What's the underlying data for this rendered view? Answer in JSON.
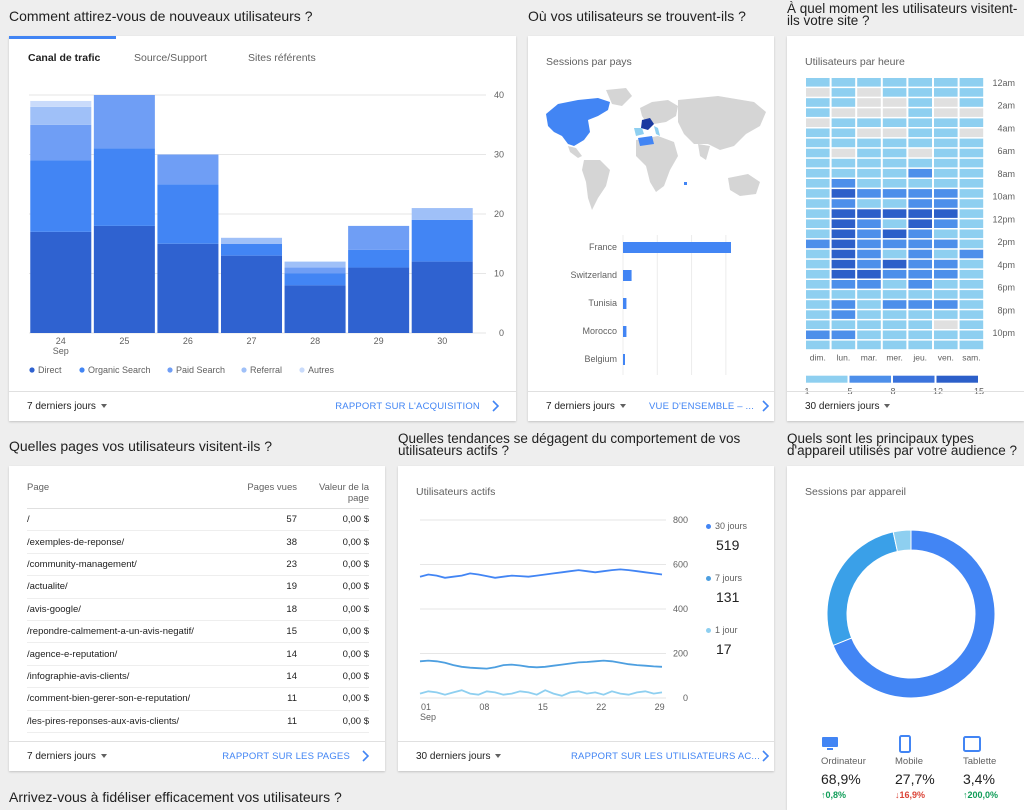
{
  "questions": {
    "acquisition": "Comment attirez-vous de nouveaux utilisateurs ?",
    "geo": "Où vos utilisateurs se trouvent-ils ?",
    "time": "À quel moment les utilisateurs visitent-ils votre site ?",
    "pages": "Quelles pages vos utilisateurs visitent-ils ?",
    "trends": "Quelles tendances se dégagent du comportement de vos utilisateurs actifs ?",
    "devices": "Quels sont les principaux types d'appareil utilisés par votre audience ?",
    "retention": "Arrivez-vous à fidéliser efficacement vos utilisateurs ?"
  },
  "acquisition": {
    "tabs": [
      "Canal de trafic",
      "Source/Support",
      "Sites référents"
    ],
    "date_range": "7 derniers jours",
    "link": "RAPPORT SUR L'ACQUISITION"
  },
  "geo": {
    "subtitle": "Sessions par pays",
    "date_range": "7 derniers jours",
    "link": "VUE D'ENSEMBLE – ..."
  },
  "time": {
    "subtitle": "Utilisateurs par heure",
    "date_range": "30 derniers jours",
    "days": [
      "dim.",
      "lun.",
      "mar.",
      "mer.",
      "jeu.",
      "ven.",
      "sam."
    ],
    "hours": [
      "12am",
      "2am",
      "4am",
      "6am",
      "8am",
      "10am",
      "12pm",
      "2pm",
      "4pm",
      "6pm",
      "8pm",
      "10pm"
    ],
    "scale_ticks": [
      "1",
      "5",
      "8",
      "12",
      "15"
    ],
    "colors": [
      "#e0e0e0",
      "#8ecff0",
      "#4d8fea",
      "#2c5fc9"
    ],
    "grid": [
      [
        1,
        1,
        1,
        1,
        1,
        1,
        1
      ],
      [
        0,
        1,
        0,
        1,
        1,
        1,
        1
      ],
      [
        1,
        1,
        0,
        0,
        1,
        0,
        1
      ],
      [
        1,
        0,
        0,
        0,
        1,
        0,
        0
      ],
      [
        0,
        1,
        1,
        1,
        1,
        1,
        1
      ],
      [
        1,
        1,
        0,
        0,
        1,
        1,
        0
      ],
      [
        1,
        1,
        1,
        1,
        1,
        1,
        1
      ],
      [
        1,
        0,
        1,
        1,
        0,
        1,
        1
      ],
      [
        1,
        1,
        1,
        1,
        1,
        1,
        1
      ],
      [
        1,
        1,
        1,
        1,
        2,
        1,
        1
      ],
      [
        1,
        2,
        1,
        1,
        1,
        1,
        1
      ],
      [
        1,
        3,
        2,
        2,
        2,
        2,
        1
      ],
      [
        1,
        2,
        1,
        1,
        2,
        2,
        1
      ],
      [
        1,
        3,
        3,
        3,
        3,
        3,
        1
      ],
      [
        1,
        3,
        2,
        1,
        3,
        2,
        1
      ],
      [
        1,
        3,
        2,
        3,
        2,
        1,
        1
      ],
      [
        2,
        3,
        2,
        2,
        2,
        2,
        1
      ],
      [
        1,
        3,
        2,
        1,
        2,
        1,
        2
      ],
      [
        1,
        3,
        2,
        3,
        2,
        2,
        1
      ],
      [
        1,
        3,
        3,
        2,
        2,
        2,
        1
      ],
      [
        1,
        2,
        2,
        1,
        2,
        1,
        1
      ],
      [
        1,
        1,
        1,
        1,
        1,
        1,
        1
      ],
      [
        1,
        2,
        1,
        2,
        2,
        2,
        1
      ],
      [
        1,
        2,
        1,
        1,
        1,
        1,
        1
      ],
      [
        1,
        1,
        1,
        1,
        1,
        0,
        1
      ],
      [
        2,
        2,
        1,
        1,
        1,
        1,
        1
      ],
      [
        1,
        1,
        1,
        1,
        1,
        1,
        1
      ]
    ]
  },
  "pages": {
    "headers": [
      "Page",
      "Pages vues",
      "Valeur de la page"
    ],
    "rows": [
      [
        "/",
        "57",
        "0,00 $"
      ],
      [
        "/exemples-de-reponse/",
        "38",
        "0,00 $"
      ],
      [
        "/community-management/",
        "23",
        "0,00 $"
      ],
      [
        "/actualite/",
        "19",
        "0,00 $"
      ],
      [
        "/avis-google/",
        "18",
        "0,00 $"
      ],
      [
        "/repondre-calmement-a-un-avis-negatif/",
        "15",
        "0,00 $"
      ],
      [
        "/agence-e-reputation/",
        "14",
        "0,00 $"
      ],
      [
        "/infographie-avis-clients/",
        "14",
        "0,00 $"
      ],
      [
        "/comment-bien-gerer-son-e-reputation/",
        "11",
        "0,00 $"
      ],
      [
        "/les-pires-reponses-aux-avis-clients/",
        "11",
        "0,00 $"
      ]
    ],
    "date_range": "7 derniers jours",
    "link": "RAPPORT SUR LES PAGES"
  },
  "trends": {
    "subtitle": "Utilisateurs actifs",
    "date_range": "30 derniers jours",
    "link": "RAPPORT SUR LES UTILISATEURS AC...",
    "summary": [
      {
        "label": "30 jours",
        "value": "519",
        "color": "#4285f4"
      },
      {
        "label": "7 jours",
        "value": "131",
        "color": "#4d9fe0"
      },
      {
        "label": "1 jour",
        "value": "17",
        "color": "#8ecff0"
      }
    ]
  },
  "devices": {
    "subtitle": "Sessions par appareil",
    "items": [
      {
        "label": "Ordinateur",
        "value": "68,9%",
        "change": "↑0,8%",
        "color": "#4285f4",
        "change_color": "#0f9d58",
        "icon": "desktop-icon"
      },
      {
        "label": "Mobile",
        "value": "27,7%",
        "change": "↓16,9%",
        "color": "#3aa0e8",
        "change_color": "#db4437",
        "icon": "mobile-icon"
      },
      {
        "label": "Tablette",
        "value": "3,4%",
        "change": "↑200,0%",
        "color": "#8ecff0",
        "change_color": "#0f9d58",
        "icon": "tablet-icon"
      }
    ]
  },
  "chart_data": [
    {
      "type": "bar",
      "title": "Canal de trafic",
      "categories": [
        "24 Sep",
        "25",
        "26",
        "27",
        "28",
        "29",
        "30"
      ],
      "ylim": [
        0,
        40
      ],
      "yticks": [
        "40",
        "30",
        "20",
        "10",
        "0"
      ],
      "legend": "bottom",
      "series": [
        {
          "name": "Direct",
          "color": "#2f62d0",
          "values": [
            17,
            18,
            15,
            13,
            8,
            11,
            12
          ]
        },
        {
          "name": "Organic Search",
          "color": "#4285f4",
          "values": [
            12,
            13,
            10,
            2,
            2,
            3,
            7
          ]
        },
        {
          "name": "Paid Search",
          "color": "#6f9ef5",
          "values": [
            6,
            9,
            5,
            0,
            1,
            4,
            0
          ]
        },
        {
          "name": "Referral",
          "color": "#9fc0f8",
          "values": [
            3,
            0,
            0,
            1,
            1,
            0,
            2
          ]
        },
        {
          "name": "Autres",
          "color": "#c9dbfb",
          "values": [
            1,
            0,
            0,
            0,
            0,
            0,
            0
          ]
        }
      ]
    },
    {
      "type": "bar",
      "title": "Sessions par pays",
      "categories": [
        "France",
        "Switzerland",
        "Tunisia",
        "Morocco",
        "Belgium"
      ],
      "values": [
        63,
        5,
        2,
        2,
        1
      ],
      "xticks": [
        "0%",
        "20%",
        "40%",
        "60%"
      ],
      "xlim": [
        0,
        70
      ],
      "color": "#4285f4"
    },
    {
      "type": "line",
      "title": "Utilisateurs actifs",
      "x_ticks": [
        "01 Sep",
        "08",
        "15",
        "22",
        "29"
      ],
      "ylim": [
        0,
        800
      ],
      "yticks": [
        "800",
        "600",
        "400",
        "200",
        "0"
      ],
      "series": [
        {
          "name": "30 jours",
          "color": "#4285f4",
          "values": [
            545,
            555,
            550,
            540,
            545,
            550,
            560,
            555,
            548,
            540,
            545,
            550,
            548,
            545,
            550,
            555,
            560,
            565,
            570,
            575,
            570,
            565,
            570,
            575,
            578,
            575,
            570,
            565,
            560,
            555
          ]
        },
        {
          "name": "7 jours",
          "color": "#4d9fe0",
          "values": [
            165,
            168,
            165,
            158,
            148,
            140,
            136,
            134,
            132,
            138,
            148,
            150,
            146,
            140,
            138,
            140,
            145,
            150,
            155,
            160,
            162,
            165,
            168,
            165,
            158,
            152,
            148,
            145,
            142,
            140
          ]
        },
        {
          "name": "1 jour",
          "color": "#8ecff0",
          "values": [
            20,
            30,
            25,
            15,
            25,
            35,
            20,
            15,
            30,
            25,
            15,
            20,
            30,
            25,
            15,
            35,
            20,
            10,
            25,
            30,
            20,
            25,
            15,
            30,
            20,
            15,
            25,
            30,
            20,
            25
          ]
        }
      ]
    },
    {
      "type": "pie",
      "title": "Sessions par appareil",
      "categories": [
        "Ordinateur",
        "Mobile",
        "Tablette"
      ],
      "values": [
        68.9,
        27.7,
        3.4
      ]
    }
  ]
}
